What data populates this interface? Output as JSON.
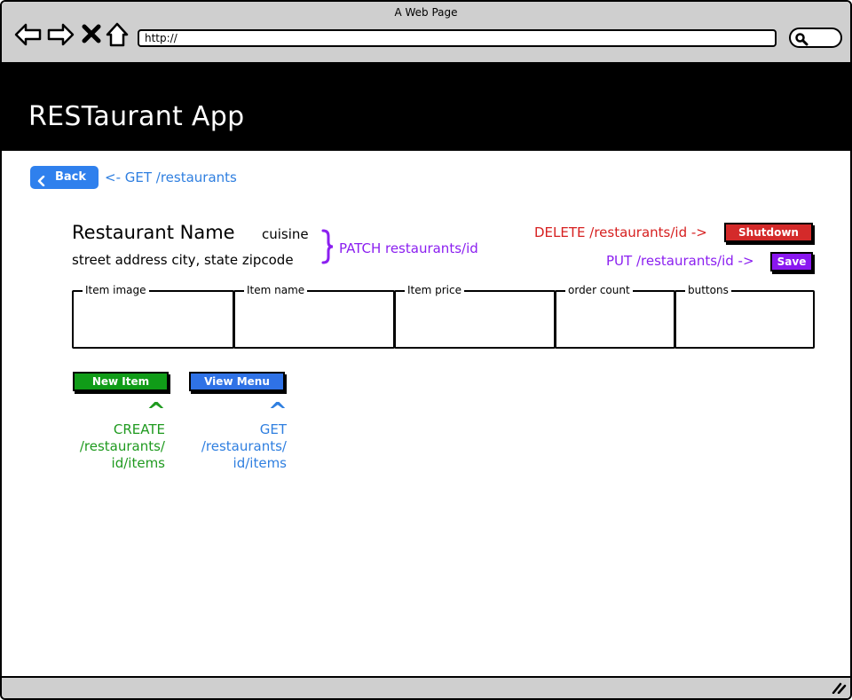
{
  "browser": {
    "window_title": "A Web Page",
    "url": "http://",
    "icons": [
      "back-arrow-icon",
      "forward-arrow-icon",
      "stop-icon",
      "home-icon",
      "search-icon",
      "resize-grip-icon"
    ]
  },
  "app": {
    "title": "RESTaurant App"
  },
  "back": {
    "label": "Back",
    "note": "<- GET /restaurants"
  },
  "restaurant": {
    "name": "Restaurant Name",
    "cuisine": "cuisine",
    "address": "street address city, state zipcode",
    "patch_note": "PATCH restaurants/id"
  },
  "actions": {
    "delete_note": "DELETE /restaurants/id ->",
    "shutdown_label": "Shutdown",
    "put_note": "PUT /restaurants/id ->",
    "save_label": "Save"
  },
  "table": {
    "columns": [
      "Item image",
      "Item name",
      "Item price",
      "order count",
      "buttons"
    ]
  },
  "bottom_actions": {
    "new_item_label": "New Item",
    "new_item_caret": "^",
    "new_item_endpoint": [
      "CREATE",
      "/restaurants/",
      "id/items"
    ],
    "view_menu_label": "View Menu",
    "view_menu_caret": "^",
    "view_menu_endpoint": [
      "GET",
      "/restaurants/",
      "id/items"
    ]
  },
  "colors": {
    "header_bg": "#000000",
    "chrome_bg": "#cfcfcf",
    "blue": "#2f80ed",
    "purple": "#8b1ff0",
    "red": "#d42a2a",
    "green": "#109c18"
  }
}
